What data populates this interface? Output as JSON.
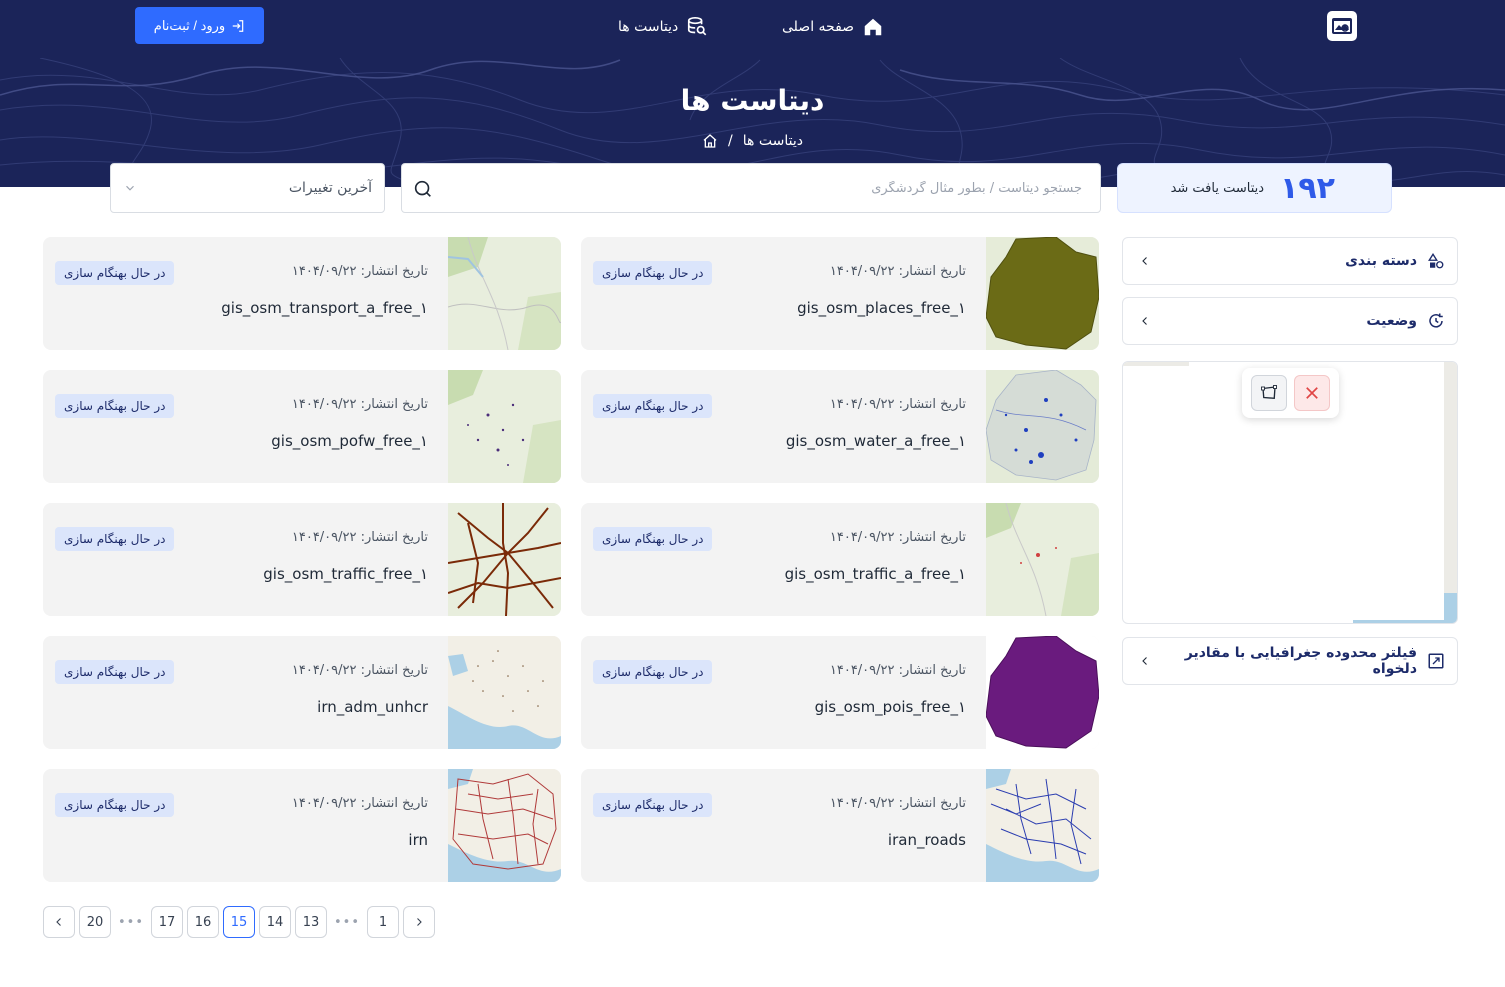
{
  "nav": {
    "home_label": "صفحه اصلی",
    "datasets_label": "دیتاست ها",
    "login_label": "ورود / ثبت‌نام"
  },
  "hero": {
    "title": "دیتاست ها",
    "breadcrumb_current": "دیتاست ها",
    "breadcrumb_sep": "/"
  },
  "search": {
    "count": "۱۹۲",
    "count_label": "دیتاست یافت شد",
    "placeholder": "جستجو دیتاست / بطور مثال گردشگری",
    "sort_label": "آخرین تغییرات"
  },
  "cards": [
    {
      "title": "gis_osm_places_free_۱",
      "date": "تاریخ انتشار: ۱۴۰۴/۰۹/۲۲",
      "status": "در حال بهنگام سازی"
    },
    {
      "title": "gis_osm_transport_a_free_۱",
      "date": "تاریخ انتشار: ۱۴۰۴/۰۹/۲۲",
      "status": "در حال بهنگام سازی"
    },
    {
      "title": "gis_osm_water_a_free_۱",
      "date": "تاریخ انتشار: ۱۴۰۴/۰۹/۲۲",
      "status": "در حال بهنگام سازی"
    },
    {
      "title": "gis_osm_pofw_free_۱",
      "date": "تاریخ انتشار: ۱۴۰۴/۰۹/۲۲",
      "status": "در حال بهنگام سازی"
    },
    {
      "title": "gis_osm_traffic_a_free_۱",
      "date": "تاریخ انتشار: ۱۴۰۴/۰۹/۲۲",
      "status": "در حال بهنگام سازی"
    },
    {
      "title": "gis_osm_traffic_free_۱",
      "date": "تاریخ انتشار: ۱۴۰۴/۰۹/۲۲",
      "status": "در حال بهنگام سازی"
    },
    {
      "title": "gis_osm_pois_free_۱",
      "date": "تاریخ انتشار: ۱۴۰۴/۰۹/۲۲",
      "status": "در حال بهنگام سازی"
    },
    {
      "title": "irn_adm_unhcr",
      "date": "تاریخ انتشار: ۱۴۰۴/۰۹/۲۲",
      "status": "در حال بهنگام سازی"
    },
    {
      "title": "iran_roads",
      "date": "تاریخ انتشار: ۱۴۰۴/۰۹/۲۲",
      "status": "در حال بهنگام سازی"
    },
    {
      "title": "irn",
      "date": "تاریخ انتشار: ۱۴۰۴/۰۹/۲۲",
      "status": "در حال بهنگام سازی"
    }
  ],
  "sidebar": {
    "category_label": "دسته بندی",
    "status_label": "وضعیت",
    "geo_filter_label": "فیلتر محدوده جغرافیایی با مقادیر دلخواه"
  },
  "pagination": {
    "pages": [
      "1",
      "13",
      "14",
      "15",
      "16",
      "17",
      "20"
    ],
    "current": "15",
    "dots": "•••"
  },
  "colors": {
    "header_bg": "#1b2459",
    "accent": "#2f6bff",
    "status_badge_bg": "#dbe5fb",
    "card_bg": "#f3f3f3"
  }
}
